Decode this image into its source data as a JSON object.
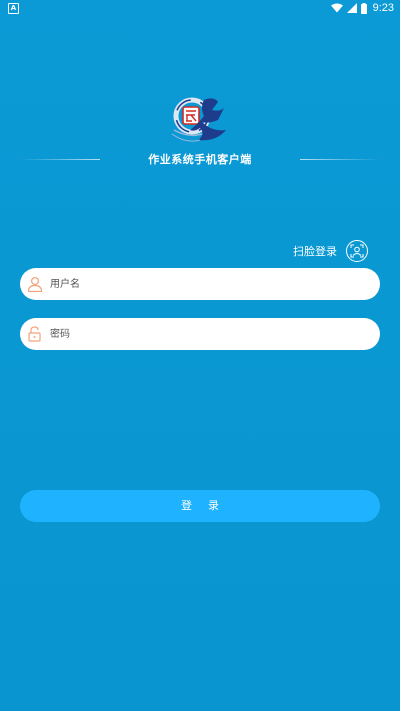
{
  "status_bar": {
    "app_icon": "A",
    "time": "9:23",
    "icons": [
      "wifi-icon",
      "signal-icon",
      "battery-icon"
    ]
  },
  "header": {
    "title": "作业系统手机客户端"
  },
  "face_login": {
    "label": "扫脸登录",
    "icon": "face-scan-icon"
  },
  "form": {
    "username_placeholder": "用户名",
    "username_value": "",
    "password_placeholder": "密码",
    "password_value": ""
  },
  "login_button": {
    "label": "登录"
  },
  "colors": {
    "background": "#0a98d4",
    "button": "#1fb3ff",
    "input_bg": "#ffffff",
    "icon_accent": "#f2a37c"
  }
}
